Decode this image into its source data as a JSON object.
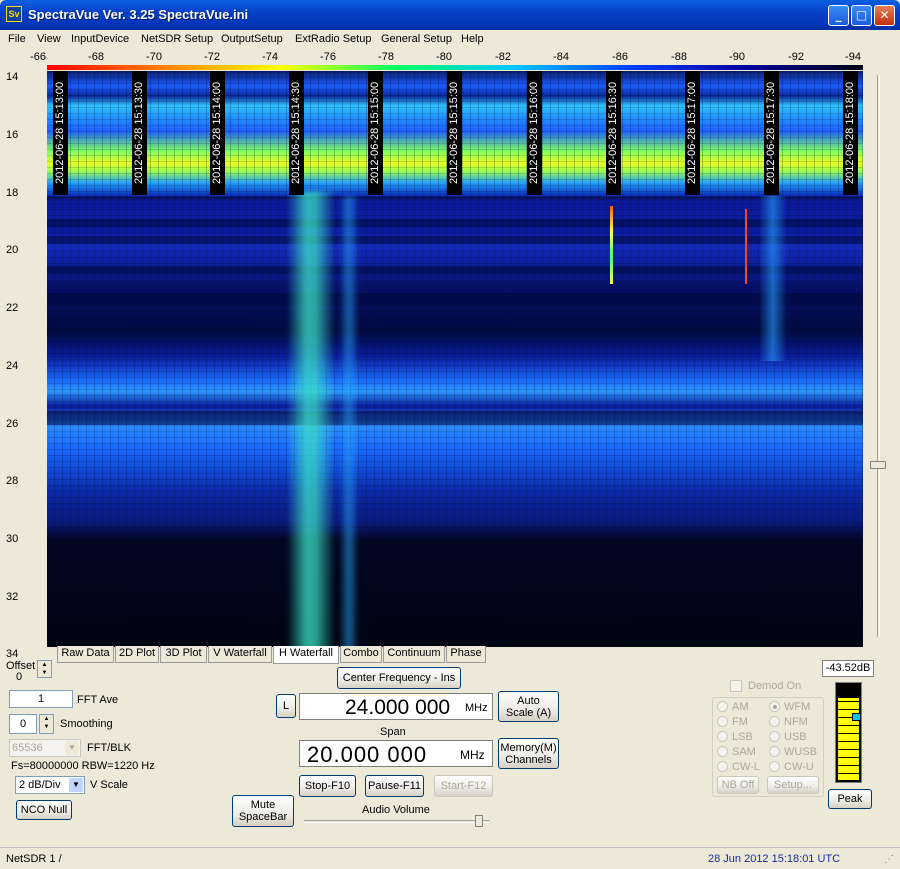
{
  "window": {
    "title": "SpectraVue Ver. 3.25  SpectraVue.ini",
    "icon": "Sv"
  },
  "menu": [
    "File",
    "View",
    "InputDevice",
    "NetSDR Setup",
    "OutputSetup",
    "ExtRadio Setup",
    "General Setup",
    "Help"
  ],
  "top_axis": [
    "-66",
    "-68",
    "-70",
    "-72",
    "-74",
    "-76",
    "-78",
    "-80",
    "-82",
    "-84",
    "-86",
    "-88",
    "-90",
    "-92",
    "-94"
  ],
  "left_axis": [
    "14",
    "16",
    "18",
    "20",
    "22",
    "24",
    "26",
    "28",
    "30",
    "32",
    "34"
  ],
  "timestamps": [
    "2012-06-28 15:13:00",
    "2012-06-28 15:13:30",
    "2012-06-28 15:14:00",
    "2012-06-28 15:14:30",
    "2012-06-28 15:15:00",
    "2012-06-28 15:15:30",
    "2012-06-28 15:16:00",
    "2012-06-28 15:16:30",
    "2012-06-28 15:17:00",
    "2012-06-28 15:17:30",
    "2012-06-28 15:18:00"
  ],
  "tabs": [
    "Raw Data",
    "2D Plot",
    "3D Plot",
    "V Waterfall",
    "H Waterfall",
    "Combo",
    "Continuum",
    "Phase"
  ],
  "active_tab": "H Waterfall",
  "controls": {
    "offset_label": "Offset",
    "offset_value": "0",
    "fft_ave_value": "1",
    "fft_ave_label": "FFT Ave",
    "smoothing_value": "0",
    "smoothing_label": "Smoothing",
    "fft_blk_value": "65536",
    "fft_blk_label": "FFT/BLK",
    "fs_rbw": "Fs=80000000 RBW=1220 Hz",
    "vscale_value": "2 dB/Div",
    "vscale_label": "V Scale",
    "nco_null": "NCO Null"
  },
  "center": {
    "center_freq_button": "Center Frequency - Ins",
    "l_button": "L",
    "freq_value": "24.000 000",
    "freq_unit": "MHz",
    "span_label": "Span",
    "span_value": "20.000 000",
    "span_unit": "MHz",
    "auto_scale": "Auto Scale (A)",
    "memory": "Memory(M) Channels",
    "stop": "Stop-F10",
    "pause": "Pause-F11",
    "start": "Start-F12",
    "mute": "Mute SpaceBar",
    "audio_volume": "Audio Volume"
  },
  "demod": {
    "demod_on": "Demod On",
    "modes": [
      "AM",
      "WFM",
      "FM",
      "NFM",
      "LSB",
      "USB",
      "SAM",
      "WUSB",
      "CW-L",
      "CW-U"
    ],
    "selected": "WFM",
    "nb_off": "NB Off",
    "setup": "Setup..."
  },
  "meter": {
    "readout": "-43.52dB",
    "peak": "Peak",
    "level": 0.85
  },
  "status": {
    "left": "NetSDR 1  /",
    "right": "28 Jun 2012  15:18:01 UTC"
  }
}
